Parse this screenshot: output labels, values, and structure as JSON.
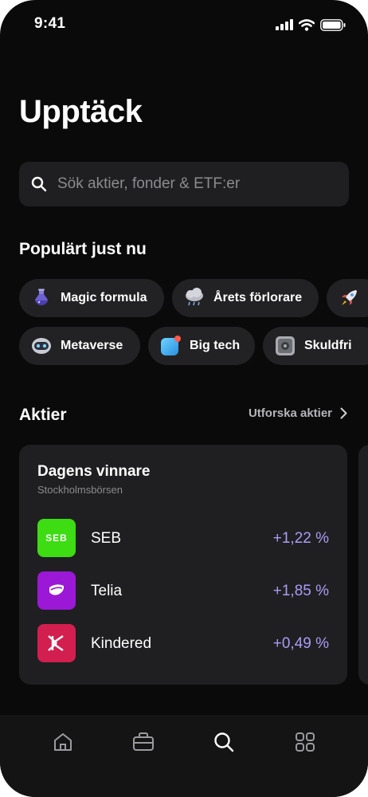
{
  "status_bar": {
    "time": "9:41"
  },
  "header": {
    "title": "Upptäck"
  },
  "search": {
    "placeholder": "Sök aktier, fonder & ETF:er"
  },
  "popular": {
    "title": "Populärt just nu",
    "chips": [
      {
        "label": "Magic formula",
        "icon": "potion-icon"
      },
      {
        "label": "Årets förlorare",
        "icon": "rain-cloud-icon"
      },
      {
        "label": "",
        "icon": "rocket-icon"
      },
      {
        "label": "Metaverse",
        "icon": "robot-icon"
      },
      {
        "label": "Big tech",
        "icon": "app-icon"
      },
      {
        "label": "Skuldfri",
        "icon": "safe-icon"
      }
    ]
  },
  "stocks": {
    "title": "Aktier",
    "explore_label": "Utforska aktier",
    "card": {
      "title": "Dagens vinnare",
      "subtitle": "Stockholmsbörsen",
      "rows": [
        {
          "name": "SEB",
          "change": "+1,22 %",
          "logo_text": "SEB",
          "logo_color": "#3ddc13"
        },
        {
          "name": "Telia",
          "change": "+1,85 %",
          "logo_text": "",
          "logo_color": "#9a18d6"
        },
        {
          "name": "Kindered",
          "change": "+0,49 %",
          "logo_text": "",
          "logo_color": "#d21f4f"
        }
      ]
    }
  },
  "colors": {
    "background": "#0a0a0a",
    "card": "#1f1f21",
    "accent_positive": "#a99cf5"
  },
  "tab_bar": {
    "tabs": [
      "home-icon",
      "briefcase-icon",
      "search-icon",
      "grid-icon"
    ]
  }
}
